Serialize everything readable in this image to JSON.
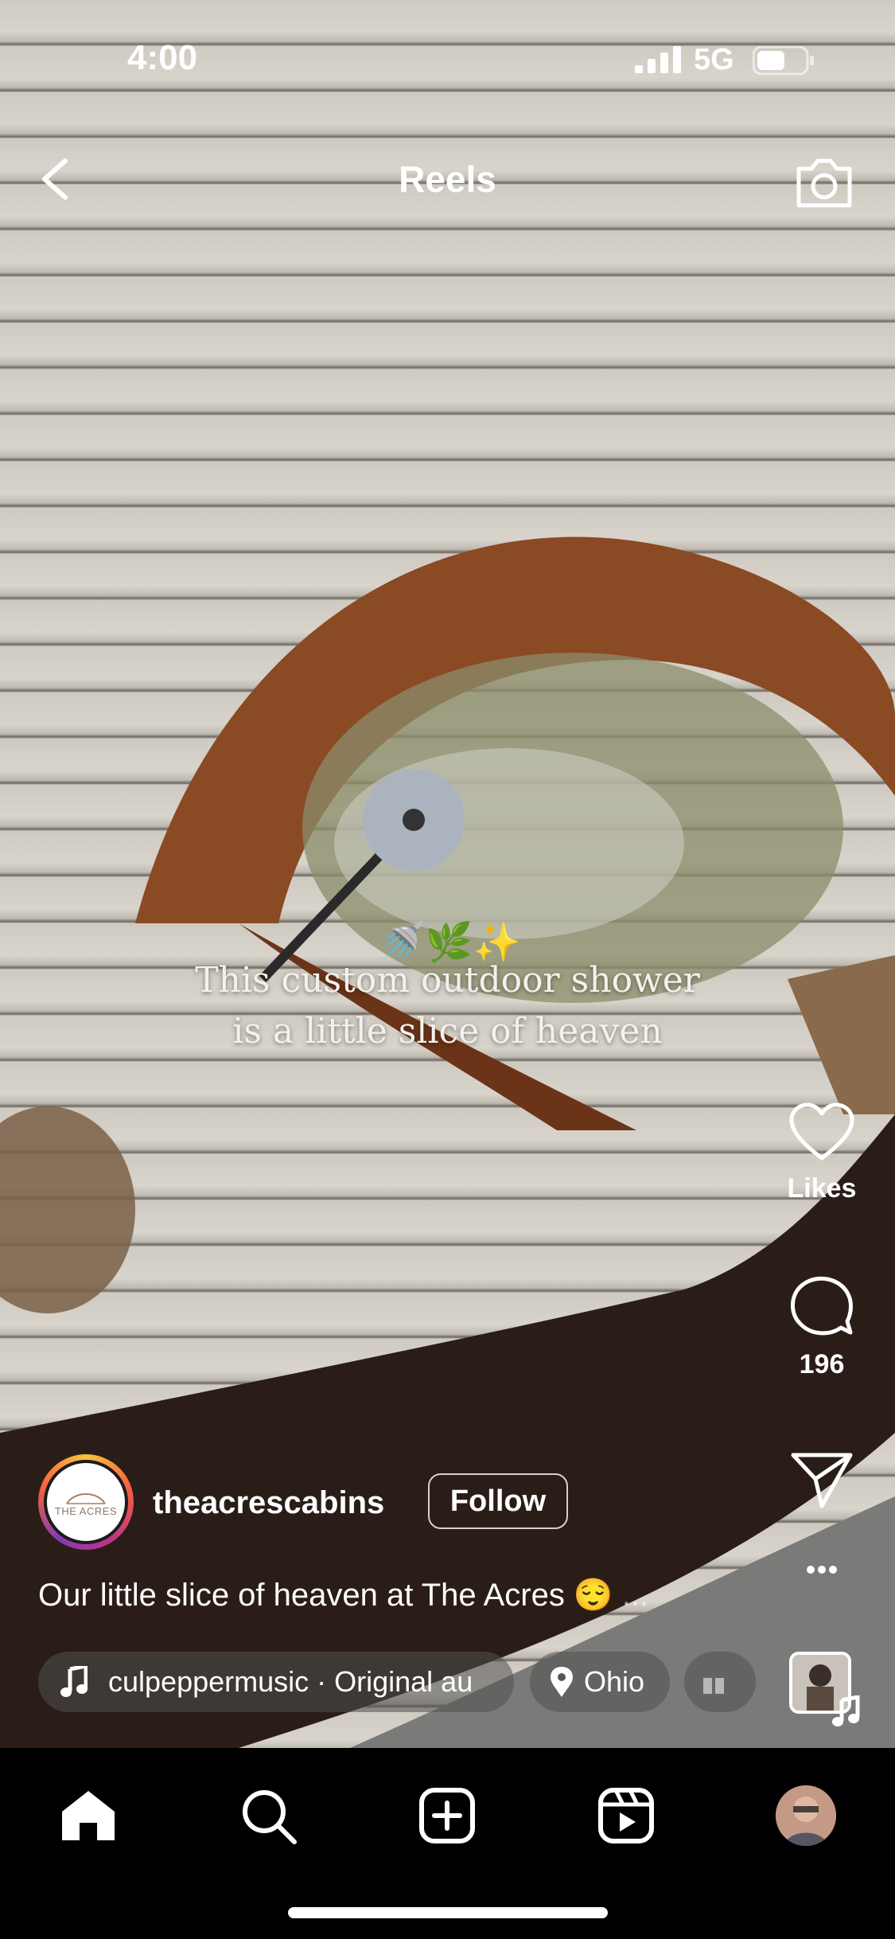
{
  "status_bar": {
    "time": "4:00",
    "network": "5G"
  },
  "header": {
    "title": "Reels"
  },
  "video": {
    "overlay_line1": "This custom outdoor shower",
    "overlay_line2": "is a little slice of heaven",
    "overlay_emojis": "🚿🌿✨"
  },
  "actions": {
    "likes_label": "Likes",
    "comments_count": "196"
  },
  "post": {
    "username": "theacrescabins",
    "avatar_text": "THE ACRES",
    "follow_label": "Follow",
    "caption": "Our little slice of heaven at The Acres 😌",
    "caption_more": "...",
    "music": "culpeppermusic · Original au",
    "location": "Ohio"
  },
  "colors": {
    "accent_ring": [
      "#f9c23c",
      "#c13584",
      "#833ab4"
    ],
    "tabbar_bg": "#000000"
  }
}
